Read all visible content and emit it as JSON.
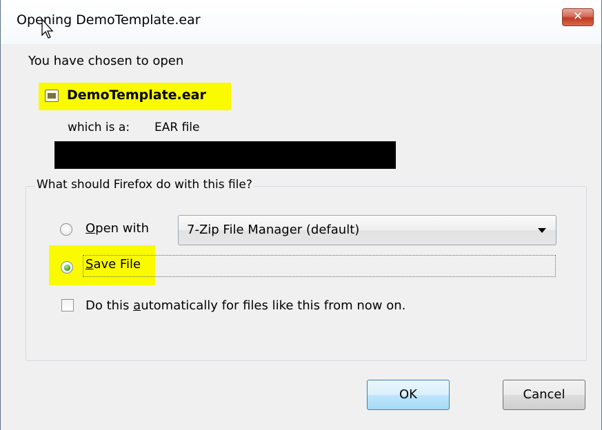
{
  "window": {
    "title": "Opening DemoTemplate.ear",
    "close_glyph": "✕"
  },
  "intro_text": "You have chosen to open",
  "file": {
    "name": "DemoTemplate.ear",
    "icon": "ear-file-icon",
    "which_is_label": "which is a:",
    "type": "EAR file"
  },
  "action_group": {
    "legend": "What should Firefox do with this file?",
    "open_with": {
      "label_pre": "",
      "label_mnemonic": "O",
      "label_post": "pen with",
      "selected": false
    },
    "app_select": {
      "value": "7-Zip File Manager (default)"
    },
    "save_file": {
      "label_mnemonic": "S",
      "label_post": "ave File",
      "selected": true
    },
    "auto_checkbox": {
      "label_pre": "Do this ",
      "label_mnemonic": "a",
      "label_post": "utomatically for files like this from now on.",
      "checked": false
    }
  },
  "buttons": {
    "ok": "OK",
    "cancel": "Cancel"
  },
  "colors": {
    "highlight": "#fbfb00",
    "redaction": "#000000",
    "close_button": "#c23a23"
  }
}
